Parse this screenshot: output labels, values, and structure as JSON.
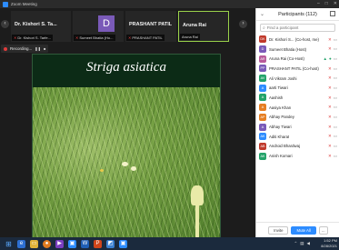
{
  "window": {
    "title": "Zoom Meeting"
  },
  "tiles": [
    {
      "name": "Dr. Kishori S. Ta...",
      "label": "Dr. Kishori S. Tarfe..."
    },
    {
      "avatar": "D",
      "label": "Sumeet Bhatia (Ho..."
    },
    {
      "name": "PRASHANT PATIL",
      "label": "PRASHANT PATIL"
    },
    {
      "name": "Aruna Rai",
      "label": "Aruna Rai"
    }
  ],
  "recording": {
    "label": "Recording..."
  },
  "slide": {
    "title": "Striga asiatica"
  },
  "participants": {
    "title": "Participants (112)",
    "search_placeholder": "Find a participant",
    "items": [
      {
        "initials": "DK",
        "name": "Dr. Kishori S... (Co-host, me)",
        "color": "#c0392b",
        "icons": [
          "mic-muted-icon",
          "video-off-icon"
        ]
      },
      {
        "initials": "D",
        "name": "Sumeet Bhatia (Host)",
        "color": "#7a5ab8",
        "icons": [
          "mic-muted-icon",
          "video-off-icon"
        ]
      },
      {
        "initials": "AR",
        "name": "Aruna Rai (Co-Host)",
        "color": "#b85a9a",
        "icons": [
          "screen-share-icon",
          "mic-icon",
          "video-off-icon"
        ]
      },
      {
        "initials": "PP",
        "name": "PRASHANT PATIL (Co-host)",
        "color": "#7a5ab8",
        "icons": [
          "mic-muted-icon",
          "video-off-icon"
        ]
      },
      {
        "initials": "AV",
        "name": "Ali Vikram Joshi",
        "color": "#23a36a",
        "icons": [
          "mic-muted-icon",
          "video-off-icon"
        ]
      },
      {
        "initials": "A",
        "name": "aarti Tiwari",
        "color": "#2d8cff",
        "icons": [
          "mic-muted-icon",
          "video-off-icon"
        ]
      },
      {
        "initials": "A",
        "name": "Aashish",
        "color": "#23a36a",
        "icons": [
          "mic-muted-icon",
          "video-off-icon"
        ]
      },
      {
        "initials": "A",
        "name": "Aasiya Khan",
        "color": "#e67e22",
        "icons": [
          "mic-muted-icon",
          "video-off-icon"
        ]
      },
      {
        "initials": "AP",
        "name": "Abhay Pandey",
        "color": "#e67e22",
        "icons": [
          "mic-muted-icon",
          "video-off-icon"
        ]
      },
      {
        "initials": "A",
        "name": "Abhay Tiwari",
        "color": "#7a5ab8",
        "icons": [
          "mic-muted-icon",
          "video-off-icon"
        ]
      },
      {
        "initials": "AK",
        "name": "Aditi Kharat",
        "color": "#2d8cff",
        "icons": [
          "mic-muted-icon",
          "video-off-icon"
        ]
      },
      {
        "initials": "AB",
        "name": "Android Bhardwaj",
        "color": "#c0392b",
        "icons": [
          "mic-muted-icon",
          "video-off-icon"
        ]
      },
      {
        "initials": "AK",
        "name": "Anish Komari",
        "color": "#23a36a",
        "icons": [
          "mic-muted-icon",
          "video-off-icon"
        ]
      }
    ],
    "buttons": {
      "invite": "Invite",
      "mute_all": "Mute All",
      "more": "..."
    }
  },
  "taskbar": {
    "time": "1:52 PM",
    "date": "8/28/2021"
  }
}
